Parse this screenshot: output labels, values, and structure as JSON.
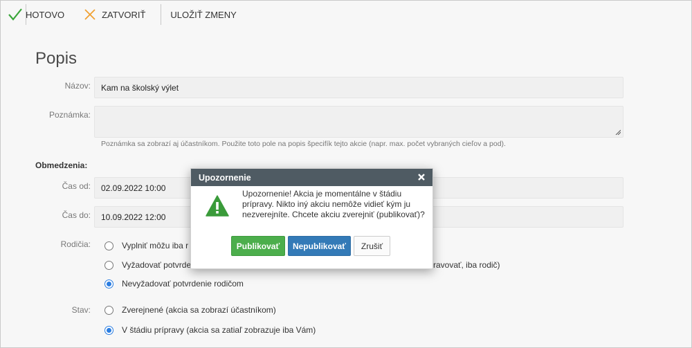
{
  "toolbar": {
    "done_label": "HOTOVO",
    "close_label": "ZATVORIŤ",
    "save_label": "ULOŽIŤ ZMENY"
  },
  "form": {
    "title": "Popis",
    "name_label": "Názov:",
    "name_value": "Kam na školský výlet",
    "note_label": "Poznámka:",
    "note_value": "",
    "note_hint": "Poznámka sa zobrazí aj účastníkom. Použite toto pole na popis špecifík tejto akcie (napr. max. počet vybraných cieľov a pod).",
    "limits_heading": "Obmedzenia:",
    "time_from_label": "Čas od:",
    "time_from_value": "02.09.2022 10:00",
    "time_to_label": "Čas do:",
    "time_to_value": "10.09.2022 12:00",
    "parents_label": "Rodičia:",
    "parents_options": [
      {
        "label": "Vyplniť môžu iba r",
        "label_tail": "",
        "selected": false
      },
      {
        "label": "Vyžadovať potvrde",
        "label_tail": "ravovať, iba rodič)",
        "selected": false
      },
      {
        "label": "Nevyžadovať potvrdenie rodičom",
        "label_tail": "",
        "selected": true
      }
    ],
    "state_label": "Stav:",
    "state_options": [
      {
        "label": "Zverejnené (akcia sa zobrazí účastníkom)",
        "selected": false
      },
      {
        "label": "V štádiu prípravy (akcia sa zatiaľ zobrazuje iba Vám)",
        "selected": true
      }
    ]
  },
  "dialog": {
    "title": "Upozornenie",
    "message": "Upozornenie! Akcia je momentálne v štádiu prípravy. Nikto iný akciu nemôže vidieť kým ju nezverejníte. Chcete akciu zverejniť (publikovať)?",
    "publish_label": "Publikovať",
    "unpublish_label": "Nepublikovať",
    "cancel_label": "Zrušiť"
  },
  "colors": {
    "done_check": "#3aa63a",
    "close_x": "#f0a030",
    "dialog_header": "#4f5b63",
    "publish_button": "#4cae4c",
    "unpublish_button": "#337ab7",
    "radio_selected": "#2a7de1",
    "warning_icon": "#3a9b3a"
  }
}
